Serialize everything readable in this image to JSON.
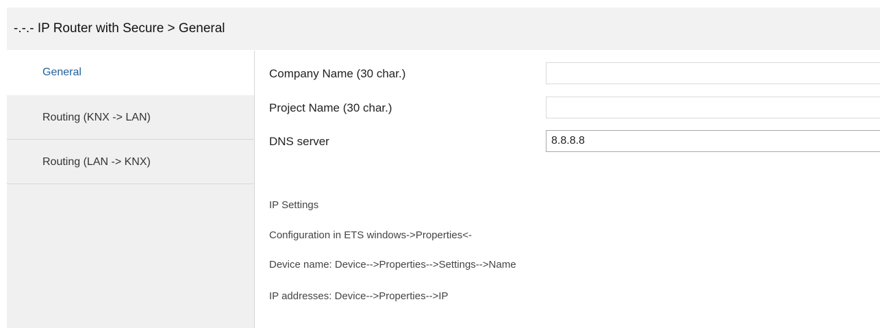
{
  "header": {
    "title": "-.-.- IP Router with Secure > General"
  },
  "sidebar": {
    "items": [
      {
        "label": "General"
      },
      {
        "label": "Routing (KNX -> LAN)"
      },
      {
        "label": "Routing (LAN -> KNX)"
      }
    ],
    "active_index": 0
  },
  "params": {
    "company_name": {
      "label": "Company Name (30 char.)",
      "value": ""
    },
    "project_name": {
      "label": "Project Name (30 char.)",
      "value": ""
    },
    "dns_server": {
      "label": "DNS server",
      "value": "8.8.8.8"
    }
  },
  "info": {
    "heading": "IP Settings",
    "lines": [
      "Configuration in ETS windows->Properties<-",
      "Device name: Device-->Properties-->Settings-->Name",
      "IP addresses: Device-->Properties-->IP"
    ]
  },
  "colors": {
    "header_bg": "#f2f2f2",
    "sidebar_bg": "#f0f0f0",
    "active_item_text": "#1f5f9a"
  }
}
